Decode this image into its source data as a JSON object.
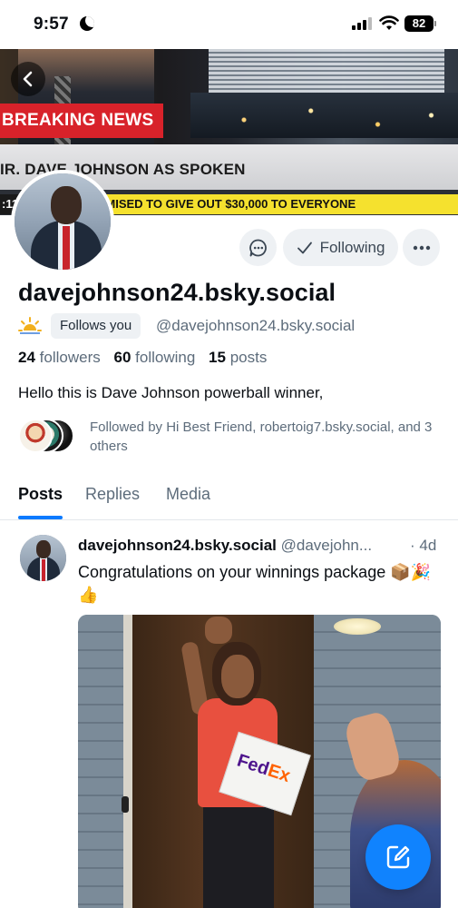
{
  "status_bar": {
    "time": "9:57",
    "battery": "82"
  },
  "banner": {
    "breaking_text": "BREAKING NEWS",
    "lower_third": "IR. DAVE JOHNSON AS SPOKEN",
    "ticker_tag": ":11",
    "ticker_text": "SPOKEN, PROMISED TO GIVE OUT $30,000 TO EVERYONE"
  },
  "actions": {
    "following_label": "Following"
  },
  "profile": {
    "display_handle": "davejohnson24.bsky.social",
    "follows_you_label": "Follows you",
    "handle": "@davejohnson24.bsky.social",
    "stats": {
      "followers_count": "24",
      "followers_label": "followers",
      "following_count": "60",
      "following_label": "following",
      "posts_count": "15",
      "posts_label": "posts"
    },
    "bio": "Hello this is Dave Johnson powerball winner,",
    "followed_by": "Followed by Hi Best Friend, robertoig7.bsky.social, and 3 others"
  },
  "tabs": [
    {
      "label": "Posts",
      "active": true
    },
    {
      "label": "Replies",
      "active": false
    },
    {
      "label": "Media",
      "active": false
    }
  ],
  "post": {
    "author_name": "davejohnson24.bsky.social",
    "author_handle": "@davejohn...",
    "time": "· 4d",
    "text": "Congratulations on your winnings package 📦🎉👍",
    "image_box_brand_fed": "Fed",
    "image_box_brand_ex": "Ex"
  },
  "colors": {
    "accent": "#1083fe",
    "tab_underline": "#0a7aff",
    "breaking_red": "#d8222a",
    "ticker_yellow": "#f5e12e",
    "muted_text": "#5d6c7b",
    "chip_bg": "#eef1f4"
  },
  "icons": {
    "back": "chevron-left-icon",
    "message": "message-icon",
    "following_check": "check-icon",
    "more": "ellipsis-icon",
    "sun": "sun-icon",
    "compose": "compose-icon"
  }
}
